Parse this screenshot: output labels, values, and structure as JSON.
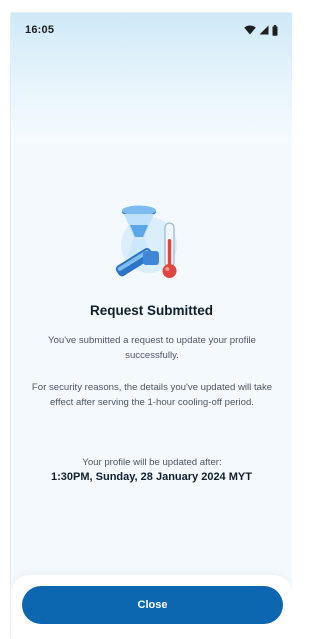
{
  "status_bar": {
    "time": "16:05",
    "icons": [
      "wifi-icon",
      "signal-icon",
      "battery-icon"
    ]
  },
  "illustration": {
    "icon": "hourglass-thermometer-icon"
  },
  "content": {
    "title": "Request Submitted",
    "message_1": "You've submitted a request to update your profile successfully.",
    "message_2": "For security reasons, the details you've updated will take effect after serving the 1-hour cooling-off period.",
    "update_label": "Your profile will be updated after:",
    "update_datetime": "1:30PM, Sunday, 28 January 2024 MYT"
  },
  "actions": {
    "close_label": "Close"
  },
  "colors": {
    "primary_button": "#0d66b0",
    "title_text": "#0f1e2c",
    "body_text": "#4a5662",
    "header_gradient_top": "#cfe9f7",
    "page_background": "#f4f9fe"
  }
}
